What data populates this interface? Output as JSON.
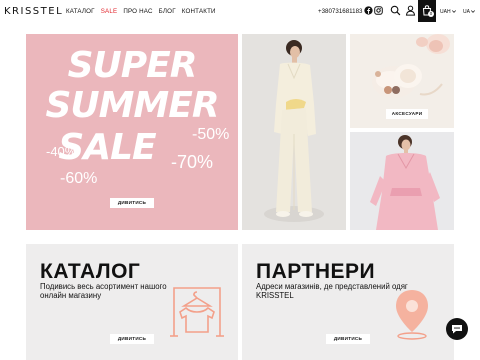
{
  "header": {
    "logo": "KRISSTEL",
    "nav": [
      {
        "label": "КАТАЛОГ"
      },
      {
        "label": "SALE"
      },
      {
        "label": "ПРО НАС"
      },
      {
        "label": "БЛОГ"
      },
      {
        "label": "КОНТАКТИ"
      }
    ],
    "phone": "+380731681183",
    "social_icons": [
      "facebook-icon",
      "instagram-icon"
    ],
    "action_icons": [
      "search-icon",
      "user-icon",
      "cart-icon"
    ],
    "cart_count": "0",
    "currency": "UAH",
    "language": "UA"
  },
  "banner": {
    "lines": [
      "SUPER",
      "SUMMER",
      "SALE"
    ],
    "discounts": [
      "-50%",
      "-40%",
      "-70%",
      "-60%"
    ],
    "button": "ДИВИТИСЬ"
  },
  "accessories": {
    "button": "АКСЕСУАРИ"
  },
  "catalog_card": {
    "title": "КАТАЛОГ",
    "text": "Подивись весь асортимент нашого онлайн магазину",
    "button": "ДИВИТИСЬ"
  },
  "partners_card": {
    "title": "ПАРТНЕРИ",
    "text": "Адреси магазинів, де представлений одяг KRISSTEL",
    "button": "ДИВИТИСЬ"
  },
  "colors": {
    "brand_pink": "#ebb7bc",
    "accent_orange": "#f3a08a",
    "sale_red": "#e2252c"
  }
}
